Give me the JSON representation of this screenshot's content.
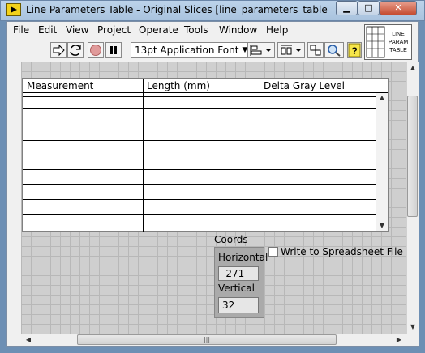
{
  "window": {
    "title": "Line Parameters Table - Original Slices [line_parameters_table - origi...]",
    "minimize_glyph": "▁",
    "maximize_glyph": "□",
    "close_glyph": "✕"
  },
  "menu": [
    "File",
    "Edit",
    "View",
    "Project",
    "Operate",
    "Tools",
    "Window",
    "Help"
  ],
  "toolbar": {
    "font_ring": "13pt Application Font",
    "icons": [
      "run-arrow-icon",
      "run-continuous-icon",
      "abort-icon",
      "pause-icon",
      "align-objects-icon",
      "distribute-objects-icon",
      "resize-objects-icon",
      "reorder-icon",
      "search-icon",
      "context-help-icon"
    ]
  },
  "vi_icon": {
    "line1": "LINE",
    "line2": "PARAM",
    "line3": "TABLE"
  },
  "table": {
    "headers": [
      "Measurement",
      "Length (mm)",
      "Delta Gray Level"
    ],
    "rows": 9
  },
  "coords": {
    "title": "Coords",
    "horizontal_label": "Horizontal",
    "horizontal_value": "-271",
    "vertical_label": "Vertical",
    "vertical_value": "32"
  },
  "spreadsheet": {
    "label": "Write to Spreadsheet File",
    "checked": false
  },
  "colors": {
    "accent_close": "#c54b2f",
    "panel_grid": "#cfcfcf",
    "title_bar": "#bcd3ea"
  }
}
